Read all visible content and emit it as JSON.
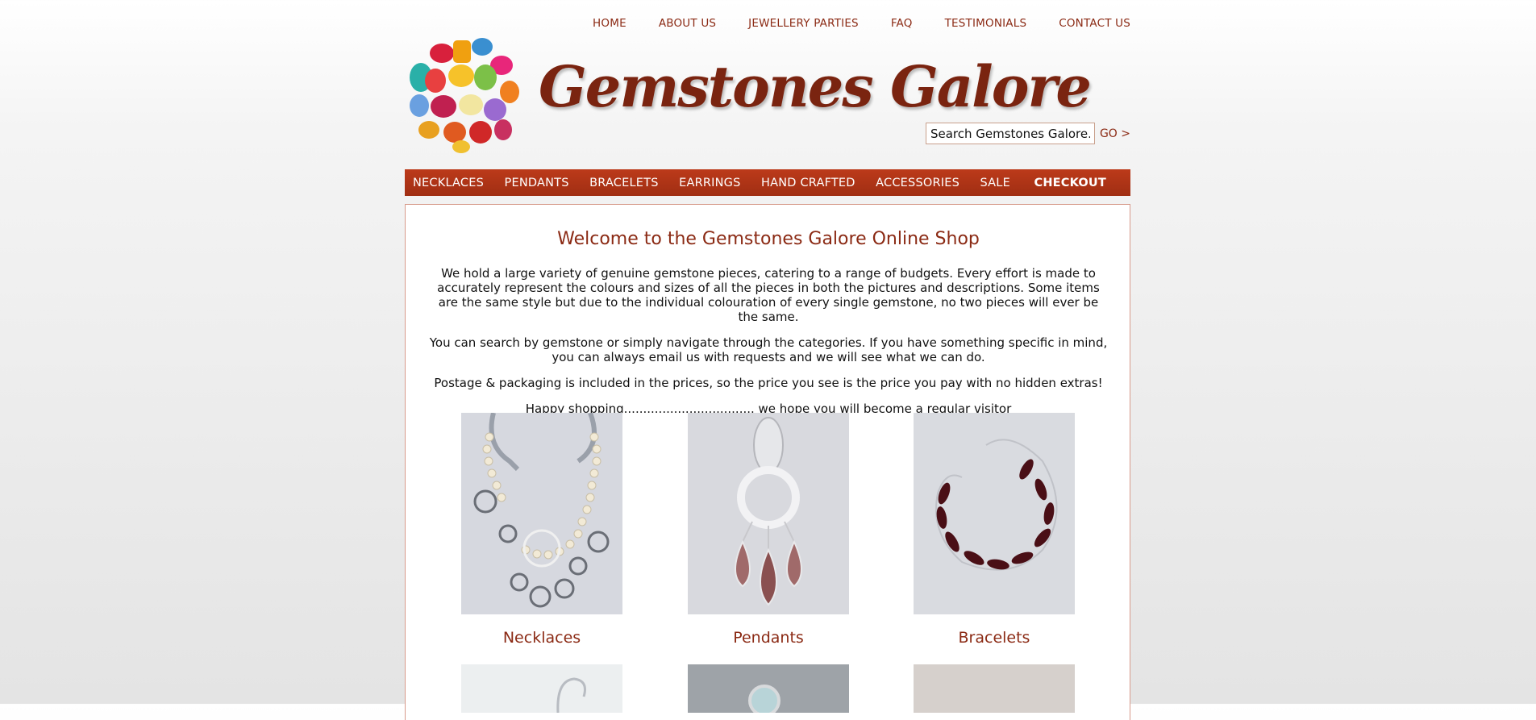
{
  "top_nav": [
    "HOME",
    "ABOUT US",
    "JEWELLERY PARTIES",
    "FAQ",
    "TESTIMONIALS",
    "CONTACT US"
  ],
  "brand": {
    "name": "Gemstones Galore"
  },
  "search": {
    "value": "Search Gemstones Galore...",
    "go_label": "GO >"
  },
  "categories": [
    "NECKLACES",
    "PENDANTS",
    "BRACELETS",
    "EARRINGS",
    "HAND CRAFTED",
    "ACCESSORIES",
    "SALE"
  ],
  "checkout_label": "CHECKOUT",
  "main": {
    "title": "Welcome to the Gemstones Galore Online Shop",
    "paragraphs": [
      "We hold a large variety of genuine gemstone pieces, catering to a range of budgets. Every effort is made to accurately represent the colours and sizes of all the pieces in both the pictures and descriptions. Some items are the same style but due to the individual colouration of every single gemstone, no two pieces will ever be the same.",
      "You can search by gemstone or simply navigate through the categories. If you have something specific in mind, you can always email us with requests and we will see what we can do.",
      "Postage & packaging is included in the prices, so the price you see is the price you pay with no hidden extras!",
      "Happy shopping.................................. we hope you will become a regular visitor"
    ],
    "tiles": [
      "Necklaces",
      "Pendants",
      "Bracelets"
    ]
  },
  "colors": {
    "accent": "#8b2a14",
    "bar": "#b03418"
  }
}
